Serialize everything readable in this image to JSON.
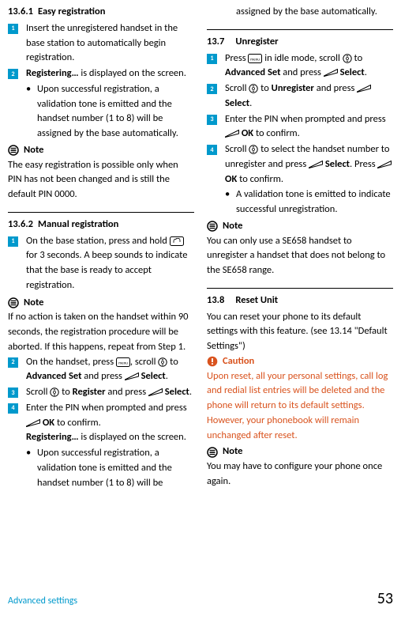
{
  "col1": {
    "h_13_6_1_num": "13.6.1",
    "h_13_6_1_title": "Easy registration",
    "s1_text": "Insert the unregistered handset in the base station to automatically begin registration.",
    "s2_pre": "Registering…",
    "s2_post": " is displayed on the screen.",
    "s2_bullet": "Upon successful registration, a validation tone is emitted and the handset number (1 to 8) will be assigned by the base automatically.",
    "note_label": "Note",
    "note1_body": "The easy registration is possible only when PIN has not been changed and is still the default PIN 0000.",
    "h_13_6_2_num": "13.6.2",
    "h_13_6_2_title": "Manual registration",
    "m1_pre": "On the base station, press and hold ",
    "m1_post": " for 3 seconds. A beep sounds to indicate that the base is ready to accept registration.",
    "note2_body": "If no action is taken on the handset within 90 seconds, the registration procedure will be aborted. If this happens, repeat from Step 1.",
    "m2_a": "On the handset, press ",
    "m2_b": ", scroll ",
    "m2_c": " to ",
    "m2_adv": "Advanced Set",
    "m2_d": " and press ",
    "m2_sel": "Select",
    "m3_a": "Scroll ",
    "m3_b": " to ",
    "m3_reg": "Register",
    "m3_c": " and press ",
    "m4_a": "Enter the PIN when prompted and press ",
    "m4_ok": "OK",
    "m4_b": " to confirm.",
    "m4_c": "Registering…",
    "m4_d": " is displayed on the screen.",
    "m4_bullet": "Upon successful registration, a validation tone is emitted and the handset number (1 to 8) will be"
  },
  "col2": {
    "top_cont": "assigned by the base automatically.",
    "h_13_7_num": "13.7",
    "h_13_7_title": "Unregister",
    "u1_a": "Press ",
    "u1_b": " in idle mode, scroll ",
    "u1_c": " to ",
    "u1_adv": "Advanced Set",
    "u1_d": " and press ",
    "u1_sel": "Select",
    "u2_a": "Scroll ",
    "u2_b": " to ",
    "u2_unreg": "Unregister",
    "u2_c": " and press ",
    "u3_a": "Enter the PIN when prompted and press ",
    "u3_ok": "OK",
    "u3_b": " to confirm.",
    "u4_a": "Scroll ",
    "u4_b": " to select the handset number to unregister and press ",
    "u4_sel": "Select",
    "u4_c": ". Press ",
    "u4_d": " to confirm.",
    "u4_bullet": "A validation tone is emitted to indicate successful unregistration.",
    "note3_body": "You can only use a SE658 handset to unregister a handset that does not belong to the SE658 range.",
    "h_13_8_num": "13.8",
    "h_13_8_title": "Reset Unit",
    "reset_body": "You can reset your phone to its default settings with this feature. (see 13.14 \"Default Settings\")",
    "caution_label": "Caution",
    "caution_body": "Upon reset, all your personal settings, call log and redial list entries will be deleted and the phone will return to its default settings. However, your phonebook will remain unchanged after reset.",
    "note4_body": "You may have to configure your phone once again."
  },
  "footer": {
    "label": "Advanced settings",
    "page": "53"
  },
  "icons": {
    "note": "note-icon",
    "caution": "caution-icon",
    "menu": "menu-button",
    "nav": "nav-button",
    "softkey": "softkey-button",
    "paging": "paging-button"
  }
}
